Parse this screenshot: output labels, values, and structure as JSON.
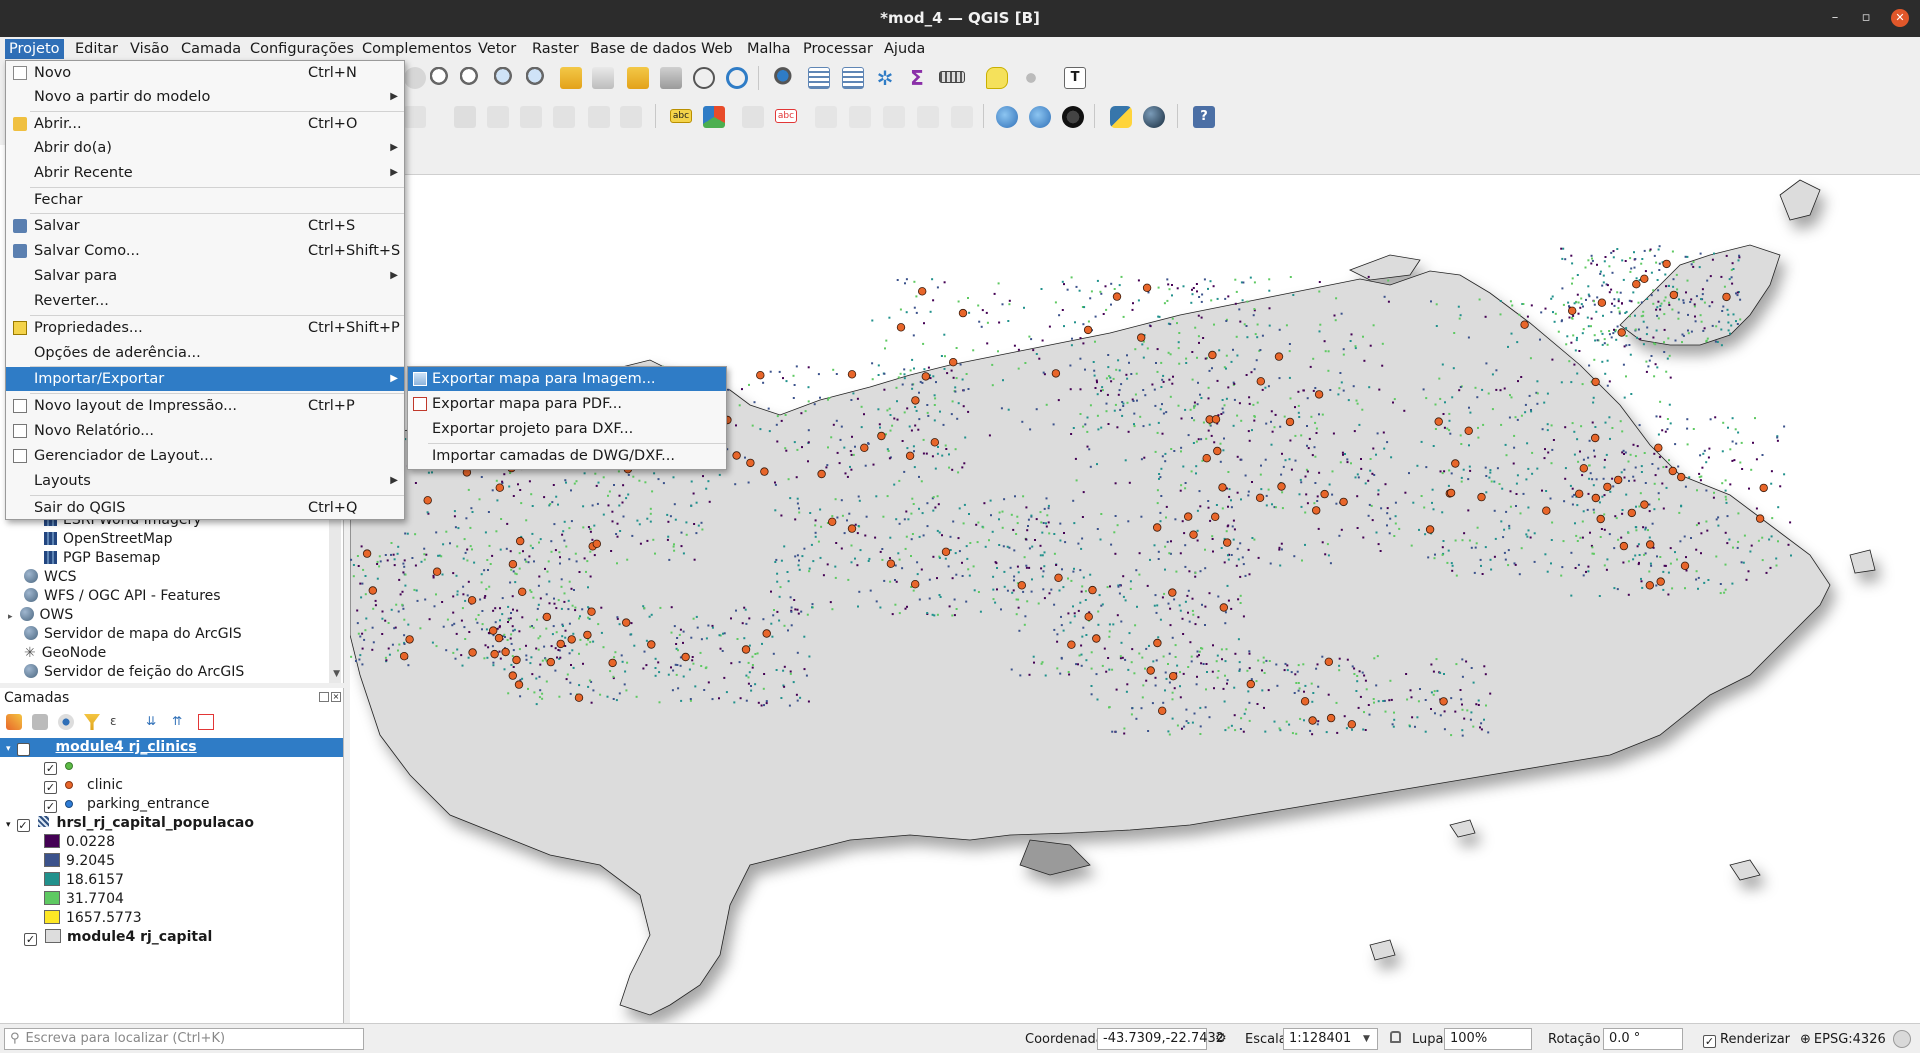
{
  "window": {
    "title": "*mod_4 — QGIS [B]",
    "minimize_glyph": "–",
    "restore_glyph": "▫",
    "close_glyph": "✕"
  },
  "menubar": {
    "items": [
      {
        "label": "Projeto",
        "active": true
      },
      {
        "label": "Editar"
      },
      {
        "label": "Visão"
      },
      {
        "label": "Camada"
      },
      {
        "label": "Configurações"
      },
      {
        "label": "Complementos"
      },
      {
        "label": "Vetor"
      },
      {
        "label": "Raster"
      },
      {
        "label": "Base de dados"
      },
      {
        "label": "Web"
      },
      {
        "label": "Malha"
      },
      {
        "label": "Processar"
      },
      {
        "label": "Ajuda"
      }
    ]
  },
  "projeto_menu": {
    "items": [
      {
        "label": "Novo",
        "shortcut": "Ctrl+N",
        "icon": "new-file-icon"
      },
      {
        "label": "Novo a partir do modelo",
        "submenu": true
      },
      {
        "label": "Abrir...",
        "shortcut": "Ctrl+O",
        "icon": "open-folder-icon"
      },
      {
        "label": "Abrir do(a)",
        "submenu": true
      },
      {
        "label": "Abrir Recente",
        "submenu": true
      },
      {
        "label": "Fechar"
      },
      {
        "label": "Salvar",
        "shortcut": "Ctrl+S",
        "icon": "save-icon"
      },
      {
        "label": "Salvar Como...",
        "shortcut": "Ctrl+Shift+S",
        "icon": "save-as-icon"
      },
      {
        "label": "Salvar para",
        "submenu": true
      },
      {
        "label": "Reverter..."
      },
      {
        "label": "Propriedades...",
        "shortcut": "Ctrl+Shift+P",
        "icon": "properties-icon"
      },
      {
        "label": "Opções de aderência..."
      },
      {
        "label": "Importar/Exportar",
        "submenu": true,
        "highlighted": true
      },
      {
        "label": "Novo layout de Impressão...",
        "shortcut": "Ctrl+P",
        "icon": "print-layout-icon"
      },
      {
        "label": "Novo Relatório...",
        "icon": "report-icon"
      },
      {
        "label": "Gerenciador de Layout...",
        "icon": "layout-manager-icon"
      },
      {
        "label": "Layouts",
        "submenu": true
      },
      {
        "label": "Sair do QGIS",
        "shortcut": "Ctrl+Q"
      }
    ]
  },
  "import_export_submenu": {
    "items": [
      {
        "label": "Exportar mapa para Imagem...",
        "highlighted": true,
        "icon": "export-image-icon"
      },
      {
        "label": "Exportar mapa para PDF...",
        "icon": "export-pdf-icon"
      },
      {
        "label": "Exportar projeto para DXF..."
      },
      {
        "label": "Importar camadas de DWG/DXF..."
      }
    ]
  },
  "browser_panel": {
    "items": [
      {
        "label": "ESRI World Imagery",
        "kind": "xyz"
      },
      {
        "label": "OpenStreetMap",
        "kind": "xyz"
      },
      {
        "label": "PGP Basemap",
        "kind": "xyz"
      },
      {
        "label": "WCS",
        "kind": "service"
      },
      {
        "label": "WFS / OGC API - Features",
        "kind": "service"
      },
      {
        "label": "OWS",
        "kind": "service",
        "expandable": true
      },
      {
        "label": "Servidor de mapa do ArcGIS",
        "kind": "service"
      },
      {
        "label": "GeoNode",
        "kind": "geonode"
      },
      {
        "label": "Servidor de feição do ArcGIS",
        "kind": "service"
      }
    ]
  },
  "layers_panel": {
    "title": "Camadas",
    "layers": [
      {
        "label": "module4 rj_clinics",
        "selected": true,
        "checked": true,
        "classes": [
          {
            "label": "",
            "color": "#5dbb46",
            "checked": true
          },
          {
            "label": "clinic",
            "color": "#e8662a",
            "checked": true
          },
          {
            "label": "parking_entrance",
            "color": "#2f7cd6",
            "checked": true
          }
        ]
      },
      {
        "label": "hrsl_rj_capital_populacao",
        "checked": true,
        "ramp": [
          {
            "label": "0.0228",
            "color": "#440154"
          },
          {
            "label": "9.2045",
            "color": "#3b528b"
          },
          {
            "label": "18.6157",
            "color": "#21918c"
          },
          {
            "label": "31.7704",
            "color": "#5ec962"
          },
          {
            "label": "1657.5773",
            "color": "#fde725"
          }
        ]
      },
      {
        "label": "module4 rj_capital",
        "checked": true,
        "color": "#dddddd"
      }
    ]
  },
  "statusbar": {
    "locator_placeholder": "Escreva para localizar (Ctrl+K)",
    "coordinate_label": "Coordenada",
    "coordinate_value": "-43.7309,-22.7432",
    "scale_label": "Escala",
    "scale_value": "1:128401",
    "magnifier_label": "Lupa",
    "magnifier_value": "100%",
    "rotation_label": "Rotação",
    "rotation_value": "0.0 °",
    "render_label": "Renderizar",
    "render_checked": true,
    "crs": "EPSG:4326"
  },
  "colors": {
    "menu_highlight": "#2f7cc6",
    "menubar_active": "#2f6fb7",
    "titlebar": "#2c2c2c",
    "land": "#dcdcdc",
    "clinic": "#e8662a"
  }
}
